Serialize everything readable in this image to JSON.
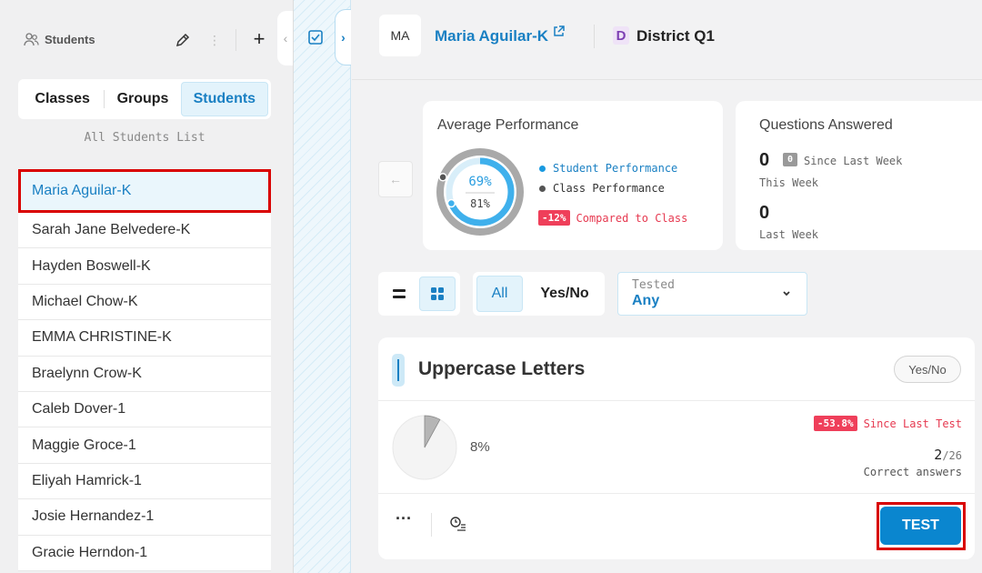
{
  "sidebar": {
    "title": "Students",
    "tabs": [
      {
        "label": "Classes",
        "active": false
      },
      {
        "label": "Groups",
        "active": false
      },
      {
        "label": "Students",
        "active": true
      }
    ],
    "list_label": "All Students List",
    "students": [
      "Maria Aguilar-K",
      "Sarah Jane Belvedere-K",
      "Hayden Boswell-K",
      "Michael Chow-K",
      "EMMA CHRISTINE-K",
      "Braelynn Crow-K",
      "Caleb Dover-1",
      "Maggie Groce-1",
      "Eliyah Hamrick-1",
      "Josie Hernandez-1",
      "Gracie Herndon-1"
    ],
    "selected_index": 0,
    "add_label": "+"
  },
  "header": {
    "avatar_initials": "MA",
    "student_name": "Maria Aguilar-K",
    "district_badge": "D",
    "district_name": "District Q1"
  },
  "performance": {
    "title": "Average Performance",
    "student_pct": 69,
    "class_pct": 81,
    "student_pct_label": "69%",
    "class_pct_label": "81%",
    "legend_student": "Student Performance",
    "legend_class": "Class Performance",
    "compare_badge": "-12%",
    "compare_label": "Compared to Class"
  },
  "questions": {
    "title": "Questions Answered",
    "this_week_value": "0",
    "since_badge": "0",
    "since_label": "Since Last Week",
    "this_week_label": "This Week",
    "last_week_value": "0",
    "last_week_label": "Last Week"
  },
  "filters": {
    "all_label": "All",
    "yesno_label": "Yes/No",
    "tested_label": "Tested",
    "tested_value": "Any"
  },
  "skill": {
    "title": "Uppercase Letters",
    "type_badge": "Yes/No",
    "pct": 8,
    "pct_label": "8%",
    "since_badge": "-53.8%",
    "since_label": "Since Last Test",
    "correct": "2",
    "total": "/26",
    "correct_label": "Correct answers",
    "more_label": "···",
    "test_button": "TEST"
  },
  "colors": {
    "accent": "#1a80c3",
    "student_ring": "#3fb0ec",
    "class_ring": "#a9a9a9",
    "negative": "#ef3f5a",
    "test_button": "#0a86cf"
  }
}
